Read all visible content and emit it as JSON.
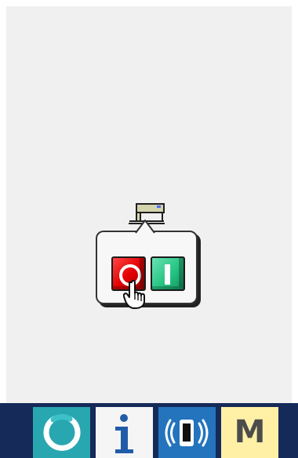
{
  "screen": {
    "background": "#f0f0f0",
    "frame_background": "#ffffff"
  },
  "main": {
    "machine_icon": "sewing-machine-icon",
    "popup": {
      "off_button_icon": "power-off-icon",
      "on_button_icon": "power-on-icon",
      "cursor_icon": "hand-cursor-icon",
      "off_color": "#e90000",
      "on_color": "#26c987"
    }
  },
  "bottom_bar": {
    "background": "#152a58",
    "buttons": [
      {
        "icon": "ready-icon",
        "color": "#28a7b1"
      },
      {
        "icon": "information-icon",
        "color": "#f5f5f5"
      },
      {
        "icon": "communication-icon",
        "color": "#2474bd"
      },
      {
        "label": "M",
        "icon": "mode-icon",
        "color": "#fff0a6"
      }
    ]
  }
}
